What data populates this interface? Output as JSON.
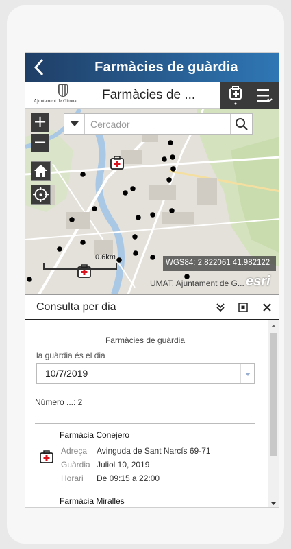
{
  "app": {
    "title": "Farmàcies de guàrdia",
    "header_title": "Farmàcies de ...",
    "logo_text": "Ajuntament de Girona"
  },
  "search": {
    "placeholder": "Cercador"
  },
  "map": {
    "zoom_in": "+",
    "zoom_out": "−",
    "coords": "WGS84: 2.822061 41.982122",
    "attribution": "UMAT. Ajuntament de G...",
    "esri": "esri",
    "scale": "0.6km",
    "marker_color": "#000000",
    "pharmacy_color": "#d9141f"
  },
  "panel": {
    "title": "Consulta per dia",
    "subtitle": "Farmàcies de guàrdia",
    "date_label": "la guàrdia és el dia",
    "date_value": "10/7/2019",
    "count": "Número ...: 2",
    "pharmacies": [
      {
        "name": "Farmàcia Conejero",
        "address_label": "Adreça",
        "address": "Avinguda de Sant Narcís 69-71",
        "guard_label": "Guàrdia",
        "guard": "Juliol 10, 2019",
        "hours_label": "Horari",
        "hours": "De 09:15 a 22:00"
      },
      {
        "name": "Farmàcia Miralles"
      }
    ]
  }
}
